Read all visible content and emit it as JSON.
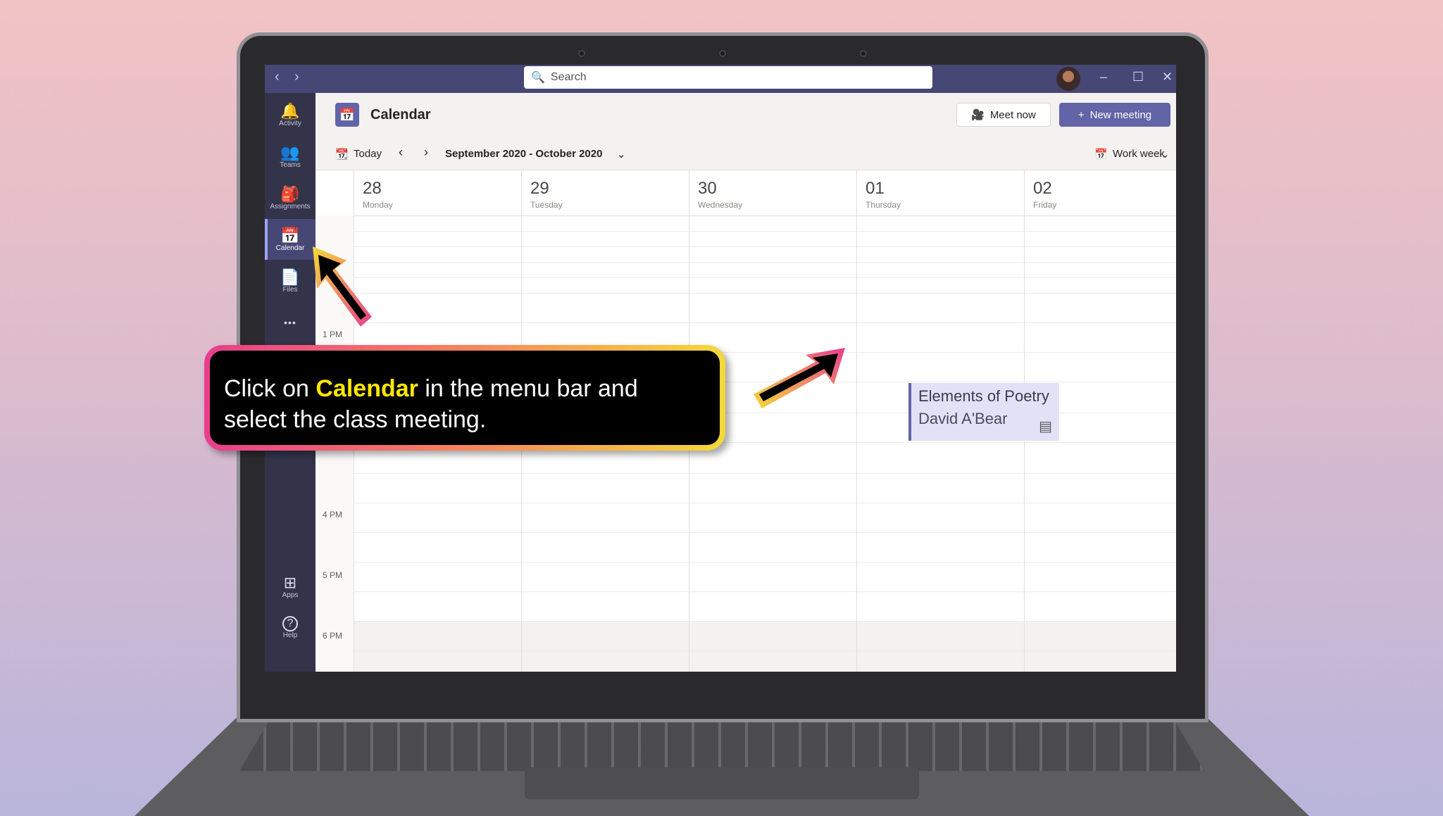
{
  "titlebar": {
    "back_arrow": "‹",
    "forward_arrow": "›",
    "search_placeholder": "Search",
    "minimize": "–",
    "maximize": "☐",
    "close": "✕"
  },
  "rail": {
    "items": [
      {
        "label": "Activity",
        "icon": "bell-icon",
        "glyph": "🔔"
      },
      {
        "label": "Teams",
        "icon": "teams-icon",
        "glyph": "👥"
      },
      {
        "label": "Assignments",
        "icon": "assignments-icon",
        "glyph": "🎒"
      },
      {
        "label": "Calendar",
        "icon": "calendar-icon",
        "glyph": "📅"
      },
      {
        "label": "Files",
        "icon": "files-icon",
        "glyph": "📄"
      },
      {
        "label": "",
        "icon": "more-icon",
        "glyph": "•••"
      }
    ],
    "bottom": [
      {
        "label": "Apps",
        "icon": "apps-icon",
        "glyph": "⊞"
      },
      {
        "label": "Help",
        "icon": "help-icon",
        "glyph": "?"
      }
    ]
  },
  "header": {
    "title": "Calendar",
    "meet_now": "Meet now",
    "new_meeting": "New meeting"
  },
  "toolbar": {
    "today": "Today",
    "range": "September 2020 - October 2020",
    "view": "Work week"
  },
  "days": [
    {
      "num": "28",
      "name": "Monday"
    },
    {
      "num": "29",
      "name": "Tuesday"
    },
    {
      "num": "30",
      "name": "Wednesday"
    },
    {
      "num": "01",
      "name": "Thursday"
    },
    {
      "num": "02",
      "name": "Friday"
    }
  ],
  "times": {
    "t1": "1 PM",
    "t4": "4 PM",
    "t5": "5 PM",
    "t6": "6 PM"
  },
  "event": {
    "title": "Elements of Poetry",
    "organizer": "David A'Bear"
  },
  "callout": {
    "pre": "Click on ",
    "highlight": "Calendar",
    "post": " in the menu bar and select the class meeting."
  },
  "colors": {
    "accent": "#6264a7",
    "titlebar": "#464775",
    "rail": "#33344a",
    "highlight": "#ffe600"
  }
}
